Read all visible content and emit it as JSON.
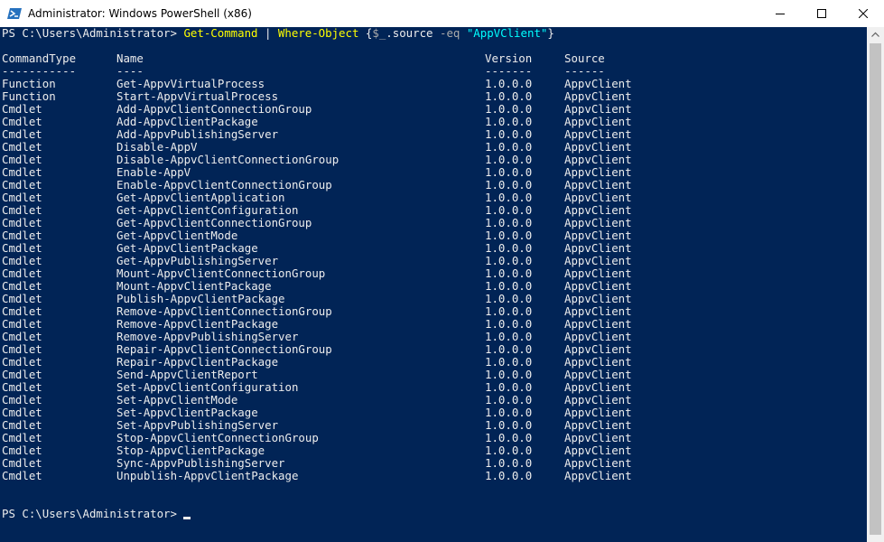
{
  "window": {
    "title": "Administrator: Windows PowerShell (x86)",
    "icon": "powershell-icon",
    "controls": [
      "minimize-icon",
      "maximize-icon",
      "close-icon"
    ]
  },
  "colors": {
    "console_bg": "#012456",
    "console_fg": "#ededed",
    "command": "#ffff00",
    "string": "#00ffff",
    "parameter": "#aaaaaa"
  },
  "console": {
    "command": {
      "prompt": "PS C:\\Users\\Administrator>",
      "cmdlet": "Get-Command",
      "pipe": "|",
      "filter": "Where-Object",
      "block_open": "{",
      "var": "$_",
      "prop": ".source",
      "op": "-eq",
      "value": "\"AppVClient\"",
      "block_close": "}"
    },
    "headers": [
      "CommandType",
      "Name",
      "Version",
      "Source"
    ],
    "separators": [
      "-----------",
      "----",
      "-------",
      "------"
    ],
    "rows": [
      [
        "Function",
        "Get-AppvVirtualProcess",
        "1.0.0.0",
        "AppvClient"
      ],
      [
        "Function",
        "Start-AppvVirtualProcess",
        "1.0.0.0",
        "AppvClient"
      ],
      [
        "Cmdlet",
        "Add-AppvClientConnectionGroup",
        "1.0.0.0",
        "AppvClient"
      ],
      [
        "Cmdlet",
        "Add-AppvClientPackage",
        "1.0.0.0",
        "AppvClient"
      ],
      [
        "Cmdlet",
        "Add-AppvPublishingServer",
        "1.0.0.0",
        "AppvClient"
      ],
      [
        "Cmdlet",
        "Disable-AppV",
        "1.0.0.0",
        "AppvClient"
      ],
      [
        "Cmdlet",
        "Disable-AppvClientConnectionGroup",
        "1.0.0.0",
        "AppvClient"
      ],
      [
        "Cmdlet",
        "Enable-AppV",
        "1.0.0.0",
        "AppvClient"
      ],
      [
        "Cmdlet",
        "Enable-AppvClientConnectionGroup",
        "1.0.0.0",
        "AppvClient"
      ],
      [
        "Cmdlet",
        "Get-AppvClientApplication",
        "1.0.0.0",
        "AppvClient"
      ],
      [
        "Cmdlet",
        "Get-AppvClientConfiguration",
        "1.0.0.0",
        "AppvClient"
      ],
      [
        "Cmdlet",
        "Get-AppvClientConnectionGroup",
        "1.0.0.0",
        "AppvClient"
      ],
      [
        "Cmdlet",
        "Get-AppvClientMode",
        "1.0.0.0",
        "AppvClient"
      ],
      [
        "Cmdlet",
        "Get-AppvClientPackage",
        "1.0.0.0",
        "AppvClient"
      ],
      [
        "Cmdlet",
        "Get-AppvPublishingServer",
        "1.0.0.0",
        "AppvClient"
      ],
      [
        "Cmdlet",
        "Mount-AppvClientConnectionGroup",
        "1.0.0.0",
        "AppvClient"
      ],
      [
        "Cmdlet",
        "Mount-AppvClientPackage",
        "1.0.0.0",
        "AppvClient"
      ],
      [
        "Cmdlet",
        "Publish-AppvClientPackage",
        "1.0.0.0",
        "AppvClient"
      ],
      [
        "Cmdlet",
        "Remove-AppvClientConnectionGroup",
        "1.0.0.0",
        "AppvClient"
      ],
      [
        "Cmdlet",
        "Remove-AppvClientPackage",
        "1.0.0.0",
        "AppvClient"
      ],
      [
        "Cmdlet",
        "Remove-AppvPublishingServer",
        "1.0.0.0",
        "AppvClient"
      ],
      [
        "Cmdlet",
        "Repair-AppvClientConnectionGroup",
        "1.0.0.0",
        "AppvClient"
      ],
      [
        "Cmdlet",
        "Repair-AppvClientPackage",
        "1.0.0.0",
        "AppvClient"
      ],
      [
        "Cmdlet",
        "Send-AppvClientReport",
        "1.0.0.0",
        "AppvClient"
      ],
      [
        "Cmdlet",
        "Set-AppvClientConfiguration",
        "1.0.0.0",
        "AppvClient"
      ],
      [
        "Cmdlet",
        "Set-AppvClientMode",
        "1.0.0.0",
        "AppvClient"
      ],
      [
        "Cmdlet",
        "Set-AppvClientPackage",
        "1.0.0.0",
        "AppvClient"
      ],
      [
        "Cmdlet",
        "Set-AppvPublishingServer",
        "1.0.0.0",
        "AppvClient"
      ],
      [
        "Cmdlet",
        "Stop-AppvClientConnectionGroup",
        "1.0.0.0",
        "AppvClient"
      ],
      [
        "Cmdlet",
        "Stop-AppvClientPackage",
        "1.0.0.0",
        "AppvClient"
      ],
      [
        "Cmdlet",
        "Sync-AppvPublishingServer",
        "1.0.0.0",
        "AppvClient"
      ],
      [
        "Cmdlet",
        "Unpublish-AppvClientPackage",
        "1.0.0.0",
        "AppvClient"
      ]
    ],
    "final_prompt": "PS C:\\Users\\Administrator>"
  }
}
